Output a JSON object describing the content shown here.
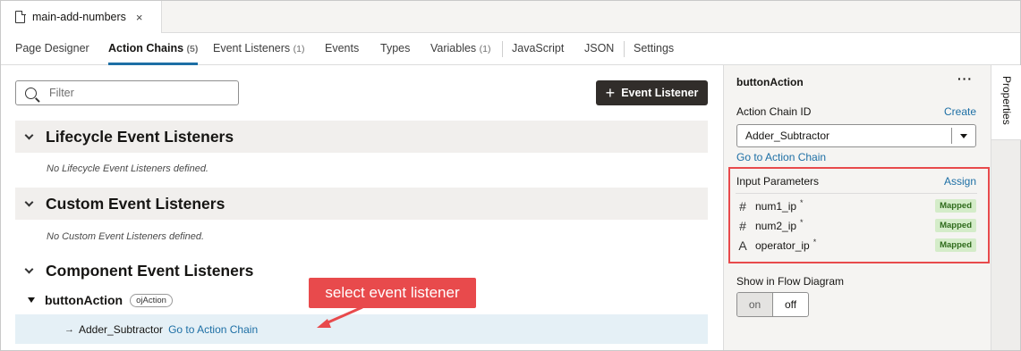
{
  "file_tab": {
    "name": "main-add-numbers",
    "close": "×"
  },
  "nav_tabs": [
    {
      "label": "Page Designer",
      "count": ""
    },
    {
      "label": "Action Chains",
      "count": "(5)"
    },
    {
      "label": "Event Listeners",
      "count": "(1)"
    },
    {
      "label": "Events",
      "count": ""
    },
    {
      "label": "Types",
      "count": ""
    },
    {
      "label": "Variables",
      "count": "(1)"
    },
    {
      "label": "JavaScript",
      "count": ""
    },
    {
      "label": "JSON",
      "count": ""
    },
    {
      "label": "Settings",
      "count": ""
    }
  ],
  "filter": {
    "placeholder": "Filter"
  },
  "add_button": {
    "plus": "+",
    "label": "Event Listener"
  },
  "sections": {
    "lifecycle": {
      "title": "Lifecycle Event Listeners",
      "empty": "No Lifecycle Event Listeners defined."
    },
    "custom": {
      "title": "Custom Event Listeners",
      "empty": "No Custom Event Listeners defined."
    },
    "component": {
      "title": "Component Event Listeners"
    }
  },
  "listener": {
    "name": "buttonAction",
    "badge": "ojAction"
  },
  "chain_row": {
    "arrow": "→",
    "chain": "Adder_Subtractor",
    "link": "Go to Action Chain"
  },
  "callout": {
    "text": "select event listener",
    "color": "#e84a4c"
  },
  "properties": {
    "title": "buttonAction",
    "more": "···",
    "chain_id_label": "Action Chain ID",
    "create_link": "Create",
    "select_value": "Adder_Subtractor",
    "goto_link": "Go to Action Chain",
    "input_params_label": "Input Parameters",
    "assign_link": "Assign",
    "params": [
      {
        "type_icon": "#",
        "name": "num1_ip",
        "req": "*",
        "status": "Mapped"
      },
      {
        "type_icon": "#",
        "name": "num2_ip",
        "req": "*",
        "status": "Mapped"
      },
      {
        "type_icon": "A",
        "name": "operator_ip",
        "req": "*",
        "status": "Mapped"
      }
    ],
    "flow_label": "Show in Flow Diagram",
    "toggle": {
      "on": "on",
      "off": "off"
    }
  },
  "rail_tab": "Properties",
  "colors": {
    "accent": "#1d6fa5",
    "highlight": "#e84a4c",
    "mapped_bg": "#d4ecc9"
  }
}
